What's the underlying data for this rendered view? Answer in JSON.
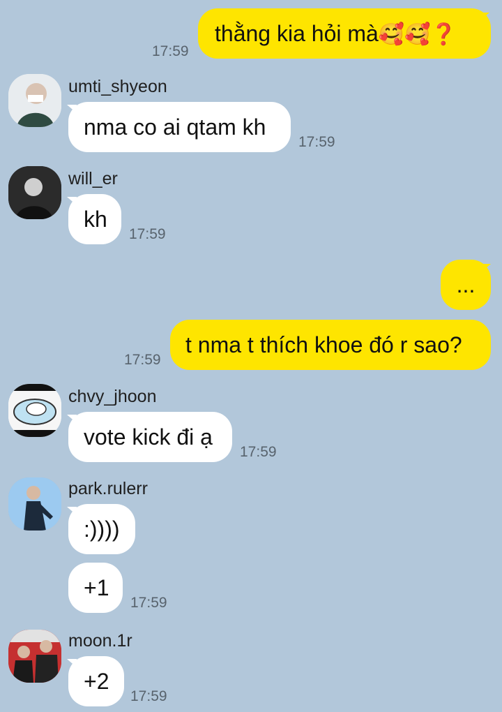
{
  "messages": {
    "m1": {
      "text": "thằng kia hỏi mà",
      "emoji": "🥰🥰❓",
      "time": "17:59"
    },
    "m2": {
      "sender": "umti_shyeon",
      "text": "nma co ai qtam kh",
      "time": "17:59"
    },
    "m3": {
      "sender": "will_er",
      "text": "kh",
      "time": "17:59"
    },
    "m4": {
      "text": "..."
    },
    "m5": {
      "text": "t nma t thích khoe đó r sao?",
      "time": "17:59"
    },
    "m6": {
      "sender": "chvy_jhoon",
      "text": "vote kick đi ạ",
      "time": "17:59"
    },
    "m7": {
      "sender": "park.rulerr",
      "text1": ":))))",
      "text2": "+1",
      "time": "17:59"
    },
    "m8": {
      "sender": "moon.1r",
      "text": "+2",
      "time": "17:59"
    }
  },
  "colors": {
    "background": "#b2c7da",
    "outgoing": "#fee500",
    "incoming": "#ffffff"
  }
}
